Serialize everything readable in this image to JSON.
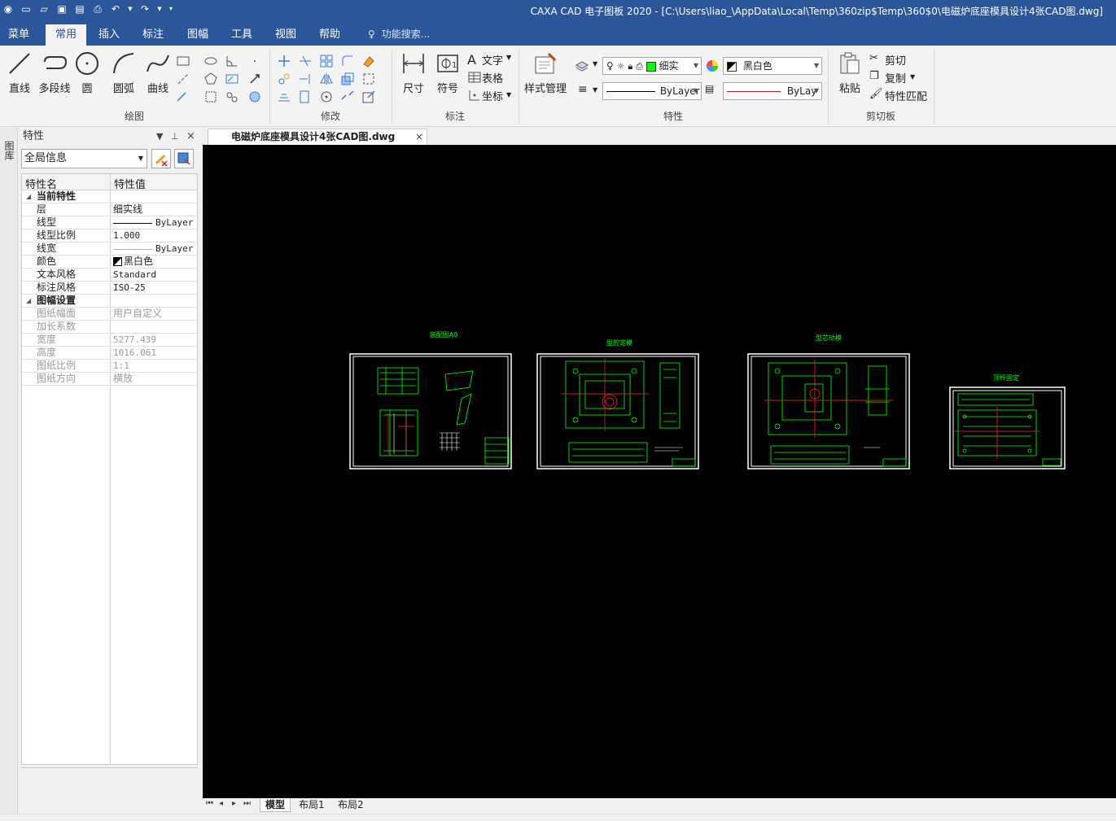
{
  "window": {
    "title": "CAXA CAD 电子图板 2020 - [C:\\Users\\liao_\\AppData\\Local\\Temp\\360zip$Temp\\360$0\\电磁炉底座模具设计4张CAD图.dwg]"
  },
  "menu_tabs": [
    {
      "label": "菜单"
    },
    {
      "label": "常用"
    },
    {
      "label": "插入"
    },
    {
      "label": "标注"
    },
    {
      "label": "图幅"
    },
    {
      "label": "工具"
    },
    {
      "label": "视图"
    },
    {
      "label": "帮助"
    }
  ],
  "search": {
    "placeholder": "功能搜索..."
  },
  "ribbon": {
    "draw": {
      "group_label": "绘图",
      "line": "直线",
      "polyline": "多段线",
      "circle": "圆",
      "arc": "圆弧",
      "curve": "曲线"
    },
    "modify": {
      "group_label": "修改"
    },
    "annotate": {
      "group_label": "标注",
      "dimension": "尺寸",
      "symbol": "符号",
      "text": "文字",
      "table": "表格",
      "coordinate": "坐标"
    },
    "properties": {
      "group_label": "特性",
      "style_manager": "样式管理",
      "layer_value": "细实",
      "color_value": "黑白色",
      "linetype_value": "ByLayer",
      "lineweight_value": "ByLay"
    },
    "clipboard": {
      "group_label": "剪切板",
      "paste": "粘贴",
      "cut": "剪切",
      "copy": "复制",
      "match_props": "特性匹配"
    }
  },
  "left_strip": {
    "tab_label": "图库"
  },
  "properties_panel": {
    "title": "特性",
    "scope": "全局信息",
    "col_name": "特性名",
    "col_value": "特性值",
    "sections": [
      {
        "label": "当前特性",
        "rows": [
          {
            "name": "层",
            "value": "细实线"
          },
          {
            "name": "线型",
            "value": "ByLayer"
          },
          {
            "name": "线型比例",
            "value": "1.000"
          },
          {
            "name": "线宽",
            "value": "ByLayer"
          },
          {
            "name": "颜色",
            "value": "黑白色"
          },
          {
            "name": "文本风格",
            "value": "Standard"
          },
          {
            "name": "标注风格",
            "value": "ISO-25"
          }
        ]
      },
      {
        "label": "图幅设置",
        "rows": [
          {
            "name": "图纸幅面",
            "value": "用户自定义"
          },
          {
            "name": "加长系数",
            "value": ""
          },
          {
            "name": "宽度",
            "value": "5277.439"
          },
          {
            "name": "高度",
            "value": "1016.061"
          },
          {
            "name": "图纸比例",
            "value": "1:1"
          },
          {
            "name": "图纸方向",
            "value": "横放"
          }
        ]
      }
    ]
  },
  "document_tab": {
    "label": "电磁炉底座模具设计4张CAD图.dwg"
  },
  "drawings": [
    {
      "title": "装配图A0"
    },
    {
      "title": "型腔定模"
    },
    {
      "title": "型芯动模"
    },
    {
      "title": "顶杆固定"
    }
  ],
  "layout_tabs": [
    {
      "label": "模型"
    },
    {
      "label": "布局1"
    },
    {
      "label": "布局2"
    }
  ],
  "colors": {
    "title_bar": "#2b579a",
    "canvas_bg": "#000000",
    "drawing_green": "#00ff00",
    "drawing_red": "#ff3030",
    "sheet_border": "#ffffff"
  }
}
